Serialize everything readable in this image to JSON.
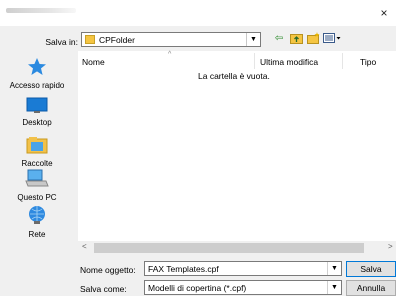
{
  "window": {
    "close_glyph": "×"
  },
  "save_in": {
    "label": "Salva in:",
    "folder": "CPFolder",
    "icon": "folder-icon"
  },
  "toolbar": [
    "back-arrow-icon",
    "up-folder-icon",
    "new-folder-icon",
    "view-menu-icon"
  ],
  "places": [
    {
      "label": "Accesso rapido",
      "icon": "star-icon"
    },
    {
      "label": "Desktop",
      "icon": "desktop-icon"
    },
    {
      "label": "Raccolte",
      "icon": "libraries-icon"
    },
    {
      "label": "Questo PC",
      "icon": "computer-icon"
    },
    {
      "label": "Rete",
      "icon": "network-icon"
    }
  ],
  "file_list": {
    "columns": [
      "Nome",
      "Ultima modifica",
      "Tipo"
    ],
    "empty_message": "La cartella è vuota."
  },
  "form": {
    "name_label": "Nome oggetto:",
    "name_value": "FAX Templates.cpf",
    "type_label": "Salva come:",
    "type_value": "Modelli di copertina (*.cpf)"
  },
  "buttons": {
    "save": "Salva",
    "cancel": "Annulla"
  },
  "colors": {
    "accent": "#0078d7",
    "folder": "#f5c542"
  }
}
